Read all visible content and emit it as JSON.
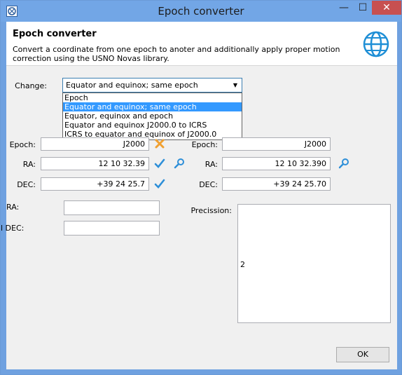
{
  "window": {
    "title": "Epoch converter",
    "min": "—",
    "max": "☐",
    "close": "✕"
  },
  "header": {
    "title": "Epoch converter",
    "description": "Convert a coordinate from one epoch to anoter and additionally apply proper motion correction using the USNO Novas library."
  },
  "change": {
    "label": "Change:",
    "selected": "Equator and equinox; same epoch",
    "options": [
      "Epoch",
      "Equator and equinox; same epoch",
      "Equator, equinox and epoch",
      "Equator and equinox J2000.0 to ICRS",
      "ICRS to equator and equinox of J2000.0"
    ]
  },
  "left": {
    "epoch_label": "Epoch:",
    "epoch_value": "J2000",
    "ra_label": "RA:",
    "ra_value": "12 10 32.39",
    "dec_label": "DEC:",
    "dec_value": "+39 24 25.7"
  },
  "right": {
    "epoch_label": "Epoch:",
    "epoch_value": "J2000",
    "ra_label": "RA:",
    "ra_value": "12 10 32.390",
    "dec_label": "DEC:",
    "dec_value": "+39 24 25.70"
  },
  "motion": {
    "ra_label": "RA:",
    "dec_label": "l DEC:"
  },
  "precision": {
    "label": "Precission:",
    "value": "2"
  },
  "ok_label": "OK",
  "colors": {
    "accent": "#3399ff",
    "titlebar": "#72a6e6",
    "close": "#c75050",
    "check": "#2e8fd8",
    "cross": "#f0a030"
  }
}
